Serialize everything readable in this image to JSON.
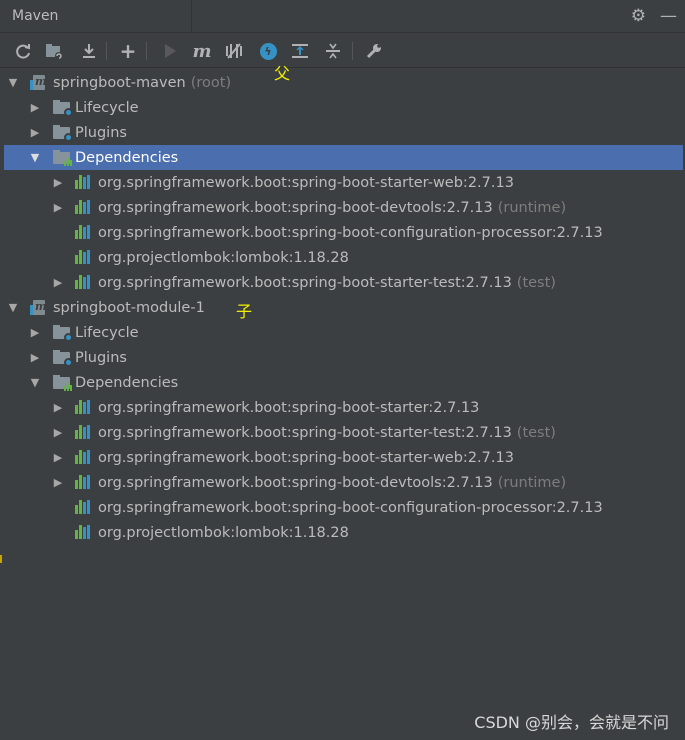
{
  "titlebar": {
    "title": "Maven"
  },
  "toolbar": {
    "buttons": [
      "reload-icon",
      "add-folder-icon",
      "download-icon",
      "add-icon",
      "run-icon",
      "maven-goal-icon",
      "toggle-offline-icon",
      "skip-tests-icon",
      "show-dependencies-icon",
      "collapse-all-icon",
      "settings-wrench-icon"
    ]
  },
  "annotations": {
    "parent": "父",
    "child": "子"
  },
  "tree": {
    "project1": {
      "name": "springboot-maven",
      "suffix": "(root)"
    },
    "project1_items": {
      "lifecycle": "Lifecycle",
      "plugins": "Plugins",
      "dependencies": "Dependencies"
    },
    "project1_deps": [
      {
        "name": "org.springframework.boot:spring-boot-starter-web:2.7.13",
        "suffix": ""
      },
      {
        "name": "org.springframework.boot:spring-boot-devtools:2.7.13",
        "suffix": "(runtime)"
      },
      {
        "name": "org.springframework.boot:spring-boot-configuration-processor:2.7.13",
        "suffix": ""
      },
      {
        "name": "org.projectlombok:lombok:1.18.28",
        "suffix": ""
      },
      {
        "name": "org.springframework.boot:spring-boot-starter-test:2.7.13",
        "suffix": "(test)"
      }
    ],
    "project2": {
      "name": "springboot-module-1",
      "suffix": ""
    },
    "project2_items": {
      "lifecycle": "Lifecycle",
      "plugins": "Plugins",
      "dependencies": "Dependencies"
    },
    "project2_deps": [
      {
        "name": "org.springframework.boot:spring-boot-starter:2.7.13",
        "suffix": ""
      },
      {
        "name": "org.springframework.boot:spring-boot-starter-test:2.7.13",
        "suffix": "(test)"
      },
      {
        "name": "org.springframework.boot:spring-boot-starter-web:2.7.13",
        "suffix": ""
      },
      {
        "name": "org.springframework.boot:spring-boot-devtools:2.7.13",
        "suffix": "(runtime)"
      },
      {
        "name": "org.springframework.boot:spring-boot-configuration-processor:2.7.13",
        "suffix": ""
      },
      {
        "name": "org.projectlombok:lombok:1.18.28",
        "suffix": ""
      }
    ]
  },
  "watermark": "CSDN @别会，会就是不问",
  "colors": {
    "background": "#3c3f41",
    "selection": "#4b6eaf",
    "accent_blue": "#3592c4",
    "annotation": "#f0f000"
  }
}
